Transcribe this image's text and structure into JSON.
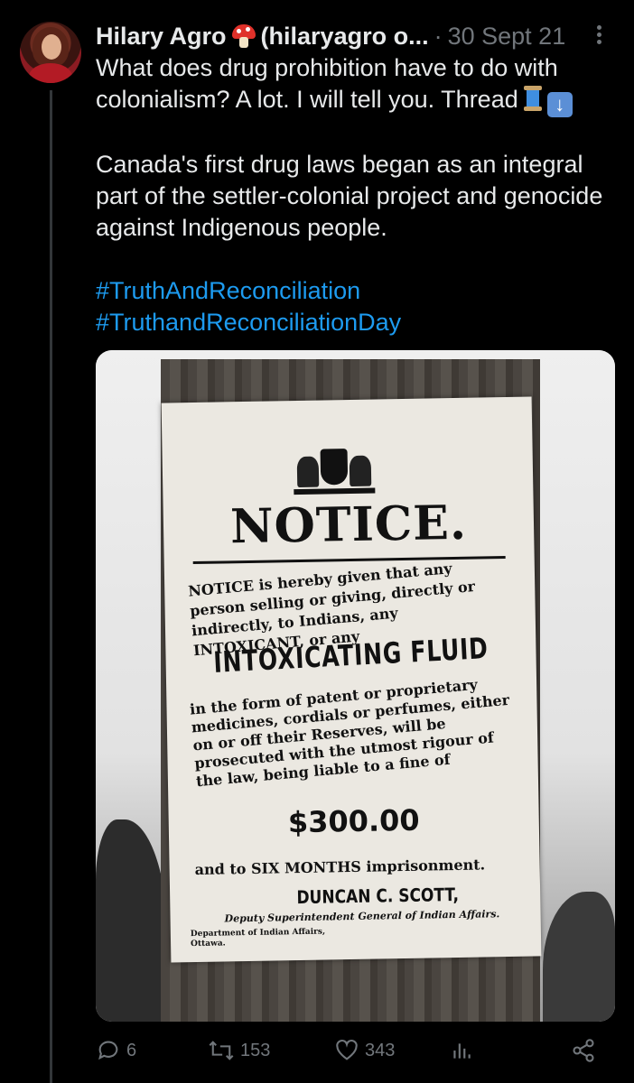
{
  "tweet": {
    "author_name": "Hilary Agro",
    "author_handle": "(hilaryagro o...",
    "separator": "·",
    "date": "30 Sept 21",
    "text_line1": "What does drug prohibition have to do with colonialism? A lot. I will tell you. Thread",
    "text_para2": "Canada's first drug laws began as an integral part of the settler-colonial project and genocide against Indigenous people.",
    "hashtags": [
      "#TruthAndReconciliation",
      "#TruthandReconciliationDay"
    ]
  },
  "poster": {
    "heading": "NOTICE.",
    "intro": "NOTICE is hereby given that any person selling or giving, directly or indirectly, to Indians, any INTOXICANT, or any",
    "fluid": "INTOXICATING FLUID",
    "body": "in the form of patent or proprietary medicines, cordials or perfumes, either on or off their Reserves, will be prosecuted with the utmost rigour of the law, being liable to a fine of",
    "amount": "$300.00",
    "imprisonment": "and to SIX MONTHS imprisonment.",
    "signer": "DUNCAN C. SCOTT,",
    "signer_title": "Deputy Superintendent General of Indian Affairs.",
    "department": "Department of Indian Affairs, Ottawa."
  },
  "actions": {
    "replies": "6",
    "retweets": "153",
    "likes": "343"
  },
  "colors": {
    "background": "#000000",
    "text": "#e7e9ea",
    "muted": "#71767b",
    "link": "#1d9bf0"
  },
  "icons": [
    "mushroom-emoji",
    "spool-emoji",
    "down-arrow-emoji",
    "more-icon",
    "reply-icon",
    "retweet-icon",
    "like-icon",
    "views-icon",
    "share-icon"
  ]
}
